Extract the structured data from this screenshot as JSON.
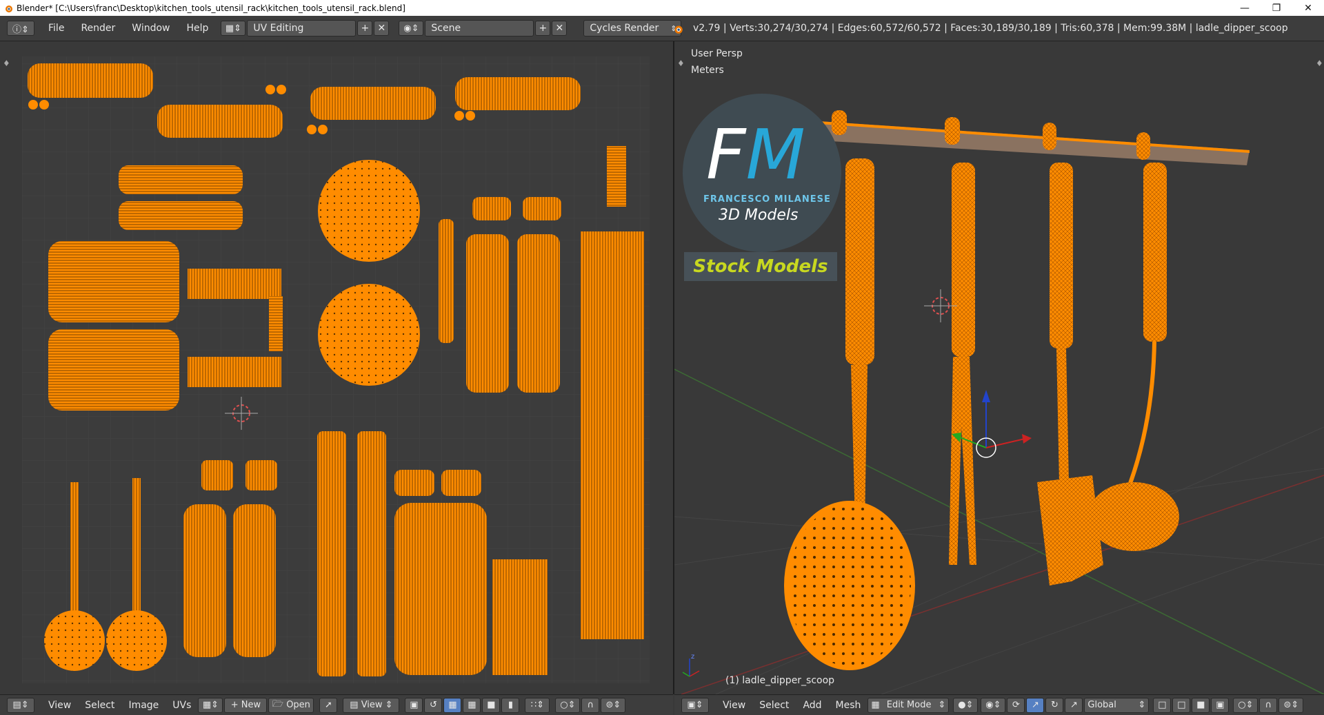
{
  "window": {
    "title": "Blender* [C:\\Users\\franc\\Desktop\\kitchen_tools_utensil_rack\\kitchen_tools_utensil_rack.blend]",
    "controls": [
      "minimize",
      "maximize",
      "close"
    ]
  },
  "info_header": {
    "menus": [
      "File",
      "Render",
      "Window",
      "Help"
    ],
    "screen_layout": "UV Editing",
    "scene": "Scene",
    "render_engine": "Cycles Render",
    "stats": "v2.79 | Verts:30,274/30,274 | Edges:60,572/60,572 | Faces:30,189/30,189 | Tris:60,378 | Mem:99.38M | ladle_dipper_scoop"
  },
  "uv_editor": {
    "footer_menus": [
      "View",
      "Select",
      "Image",
      "UVs"
    ],
    "new_label": "New",
    "open_label": "Open",
    "view_label": "View"
  },
  "viewport": {
    "view_name": "User Persp",
    "units": "Meters",
    "object_label": "(1) ladle_dipper_scoop",
    "watermark": {
      "letters_f": "F",
      "letters_m": "M",
      "brand": "FRANCESCO MILANESE",
      "tagline": "3D Models",
      "badge": "Stock Models"
    },
    "footer_menus": [
      "View",
      "Select",
      "Add",
      "Mesh"
    ],
    "mode": "Edit Mode",
    "orientation": "Global"
  },
  "colors": {
    "mesh": "#ff8c00",
    "background": "#393939",
    "accent": "#5680c2"
  }
}
